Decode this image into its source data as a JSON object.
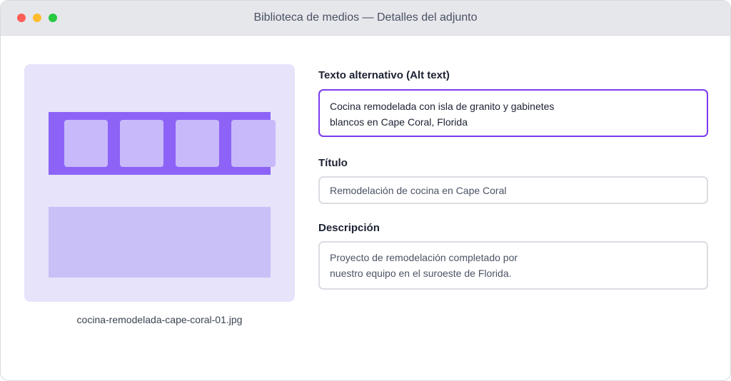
{
  "window": {
    "title": "Biblioteca de medios — Detalles del adjunto"
  },
  "preview": {
    "filename": "cocina-remodelada-cape-coral-01.jpg"
  },
  "fields": {
    "alt": {
      "label": "Texto alternativo (Alt text)",
      "line1": "Cocina remodelada con isla de granito y gabinetes",
      "line2": "blancos en Cape Coral, Florida"
    },
    "title": {
      "label": "Título",
      "value": "Remodelación de cocina en Cape Coral"
    },
    "description": {
      "label": "Descripción",
      "line1": "Proyecto de remodelación completado por",
      "line2": "nuestro equipo en el suroeste de Florida."
    }
  },
  "colors": {
    "accent": "#7c3aed",
    "banner": "#8c63f6",
    "preview_bg": "#e6e3fa",
    "close": "#ff5f57",
    "minimize": "#febc2e",
    "zoom": "#28c840"
  }
}
